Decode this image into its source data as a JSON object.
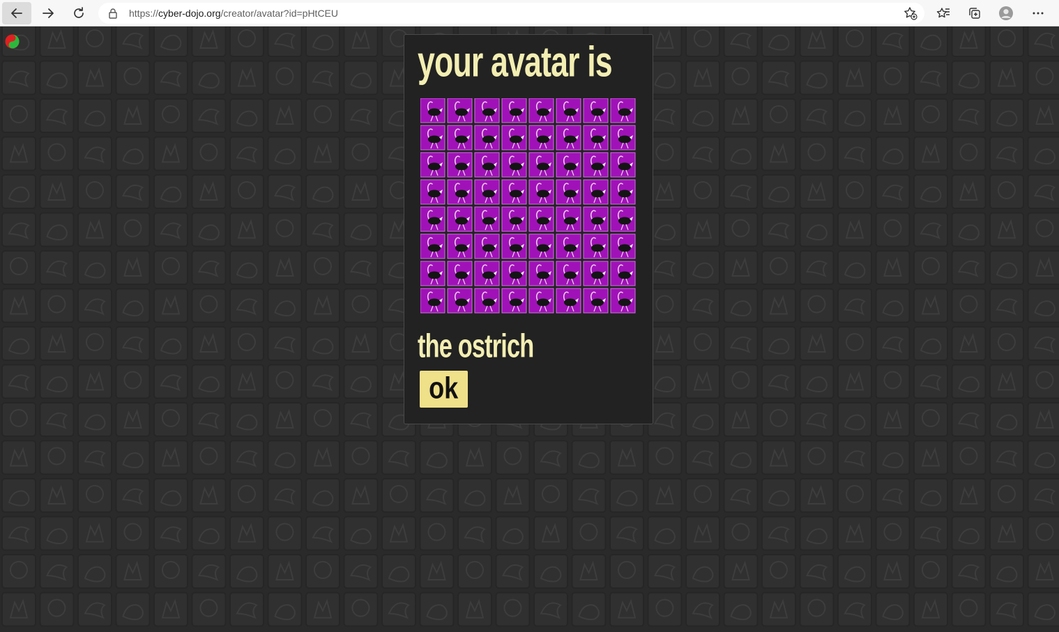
{
  "browser": {
    "url_scheme": "https://",
    "url_host": "cyber-dojo.org",
    "url_path": "/creator/avatar?id=pHtCEU",
    "icons": [
      "back-icon",
      "forward-icon",
      "refresh-icon",
      "lock-icon",
      "add-favorite-icon",
      "favorites-icon",
      "collections-icon",
      "profile-icon",
      "more-icon"
    ]
  },
  "page": {
    "logo_icon": "cyber-dojo-yin-yang-logo",
    "background_icon": "animal-silhouette-tiles"
  },
  "dialog": {
    "heading": "your avatar is",
    "animal_name": "the ostrich",
    "ok_label": "ok",
    "avatar_icon": "ostrich-icon",
    "grid_rows": 8,
    "grid_cols": 8,
    "tile_color": "#a012b8",
    "text_color": "#f3eeb2",
    "button_color": "#efe08a"
  }
}
